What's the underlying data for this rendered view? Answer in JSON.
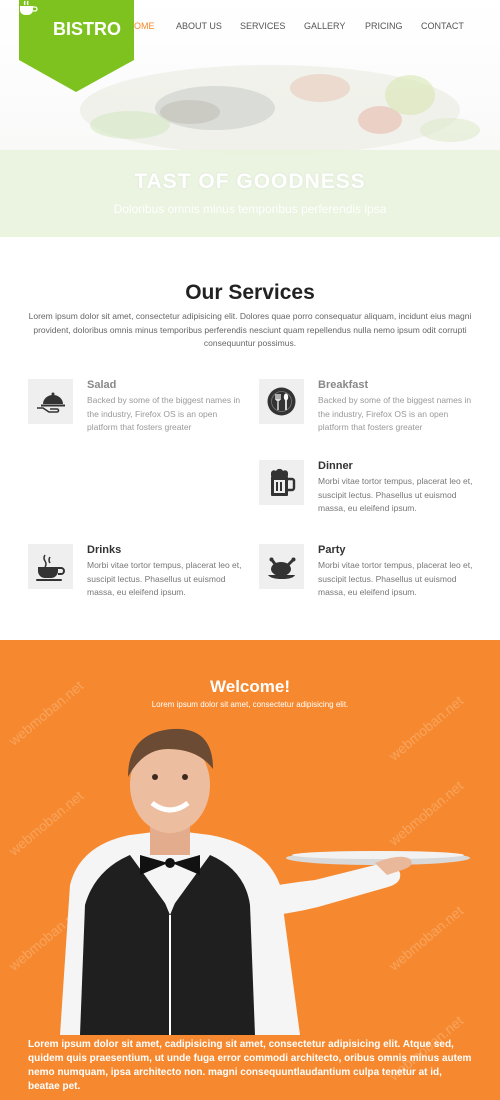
{
  "brand": {
    "name": "BISTRO",
    "logo_color": "#7dc21e"
  },
  "nav": {
    "items": [
      {
        "label": "OME",
        "active": true
      },
      {
        "label": "ABOUT US"
      },
      {
        "label": "SERVICES"
      },
      {
        "label": "GALLERY"
      },
      {
        "label": "PRICING"
      },
      {
        "label": "CONTACT"
      }
    ],
    "active_color": "#f58a2b"
  },
  "hero": {
    "title": "TAST OF GOODNESS",
    "subtitle": "Doloribus omnis minus temporibus perferendis ipsa"
  },
  "services": {
    "title": "Our Services",
    "intro": "Lorem ipsum dolor sit amet, consectetur adipisicing elit. Dolores quae porro consequatur aliquam, incidunt eius magni provident, doloribus omnis minus temporibus perferendis nesciunt quam repellendus nulla nemo ipsum odit corrupti consequuntur possimus.",
    "items": [
      {
        "title": "Salad",
        "icon": "cloche-icon",
        "text": "Backed by some of the biggest names in the industry, Firefox OS is an open platform that fosters greater"
      },
      {
        "title": "Breakfast",
        "icon": "plate-cutlery-icon",
        "text": "Backed by some of the biggest names in the industry, Firefox OS is an open platform that fosters greater"
      },
      {
        "title": "Dinner",
        "icon": "beer-mug-icon",
        "text": "Morbi vitae tortor tempus, placerat leo et, suscipit lectus. Phasellus ut euismod massa, eu eleifend ipsum."
      },
      {
        "title": "Drinks",
        "icon": "coffee-cup-icon",
        "text": "Morbi vitae tortor tempus, placerat leo et, suscipit lectus. Phasellus ut euismod massa, eu eleifend ipsum."
      },
      {
        "title": "Party",
        "icon": "roast-chicken-icon",
        "text": "Morbi vitae tortor tempus, placerat leo et, suscipit lectus. Phasellus ut euismod massa, eu eleifend ipsum."
      }
    ]
  },
  "welcome": {
    "title": "Welcome!",
    "subtitle": "Lorem ipsum dolor sit amet, consectetur adipisicing elit.",
    "body": "Lorem ipsum dolor sit amet, cadipisicing sit amet, consectetur adipisicing elit. Atque sed, quidem quis praesentium, ut unde fuga error commodi architecto, oribus omnis minus autem nemo numquam, ipsa architecto non. magni consequuntlaudantium culpa tenetur at id, beatae pet.",
    "background": "#f6892f"
  },
  "watermark": "webmoban.net"
}
